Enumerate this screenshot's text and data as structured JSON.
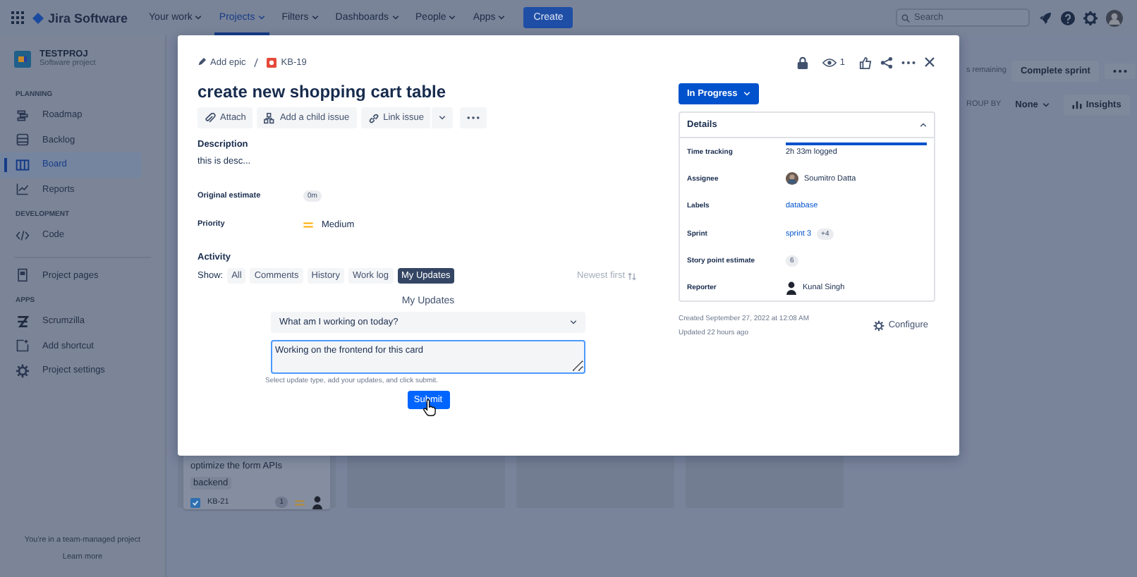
{
  "top_nav": {
    "product": "Jira Software",
    "menus": [
      {
        "label": "Your work",
        "selected": false
      },
      {
        "label": "Projects",
        "selected": true
      },
      {
        "label": "Filters",
        "selected": false
      },
      {
        "label": "Dashboards",
        "selected": false
      },
      {
        "label": "People",
        "selected": false
      },
      {
        "label": "Apps",
        "selected": false
      }
    ],
    "create": "Create",
    "search_placeholder": "Search"
  },
  "sidebar": {
    "project": {
      "name": "TESTPROJ",
      "type": "Software project"
    },
    "sections": [
      {
        "items": [
          {
            "label": "Roadmap",
            "selected": false
          },
          {
            "label": "Backlog",
            "selected": false
          },
          {
            "label": "Board",
            "selected": true
          },
          {
            "label": "Reports",
            "selected": false
          }
        ],
        "heading": "PLANNING"
      },
      {
        "heading": "DEVELOPMENT",
        "items": [
          {
            "label": "Code",
            "selected": false
          }
        ]
      },
      {
        "items": [
          {
            "label": "Project pages",
            "selected": false
          }
        ]
      },
      {
        "heading": "APPS",
        "items": [
          {
            "label": "Scrumzilla",
            "selected": false
          },
          {
            "label": "Add shortcut",
            "selected": false
          },
          {
            "label": "Project settings",
            "selected": false
          }
        ]
      }
    ],
    "footer": {
      "text": "You're in a team-managed project",
      "link": "Learn more"
    }
  },
  "board": {
    "remaining": "s remaining",
    "complete": "Complete sprint",
    "group_by": "ROUP BY",
    "group_value": "None",
    "insights": "Insights",
    "card": {
      "title": "optimize the form APIs",
      "label": "backend",
      "key": "KB-21",
      "points": "1"
    }
  },
  "issue": {
    "epic": "Add epic",
    "key": "KB-19",
    "watchers": "1",
    "title": "create new shopping cart table",
    "actions": [
      "Attach",
      "Add a child issue",
      "Link issue"
    ],
    "description": {
      "heading": "Description",
      "text": "this is desc..."
    },
    "fields": [
      {
        "label": "Original estimate",
        "kind": "badge",
        "value": "0m"
      },
      {
        "label": "Priority",
        "kind": "priority",
        "value": "Medium"
      }
    ],
    "activity": {
      "heading": "Activity",
      "show": "Show:",
      "filters": [
        {
          "label": "All",
          "selected": false
        },
        {
          "label": "Comments",
          "selected": false
        },
        {
          "label": "History",
          "selected": false
        },
        {
          "label": "Work log",
          "selected": false
        },
        {
          "label": "My Updates",
          "selected": true
        }
      ],
      "sort": "Newest first"
    },
    "updates": {
      "heading": "My Updates",
      "select": "What am I working on today?",
      "text": "Working on the frontend for this card",
      "hint": "Select update type, add your updates, and click submit.",
      "submit": "Submit"
    },
    "status": "In Progress",
    "details": {
      "heading": "Details",
      "expanded": true,
      "rows": [
        {
          "label": "Time tracking",
          "kind": "progress",
          "level": 1,
          "value": "2h 33m logged"
        },
        {
          "label": "Assignee",
          "kind": "person",
          "value": "Soumitro Datta"
        },
        {
          "label": "Labels",
          "kind": "link",
          "value": "database"
        },
        {
          "label": "Sprint",
          "kind": "link",
          "value": "sprint 3",
          "extra": "+4"
        },
        {
          "label": "Story point estimate",
          "kind": "badge",
          "value": "6"
        },
        {
          "label": "Reporter",
          "kind": "person",
          "value": "Kunal Singh"
        }
      ]
    },
    "created": "Created September 27, 2022 at 12:08 AM",
    "updated": "Updated 22 hours ago",
    "configure": "Configure"
  }
}
